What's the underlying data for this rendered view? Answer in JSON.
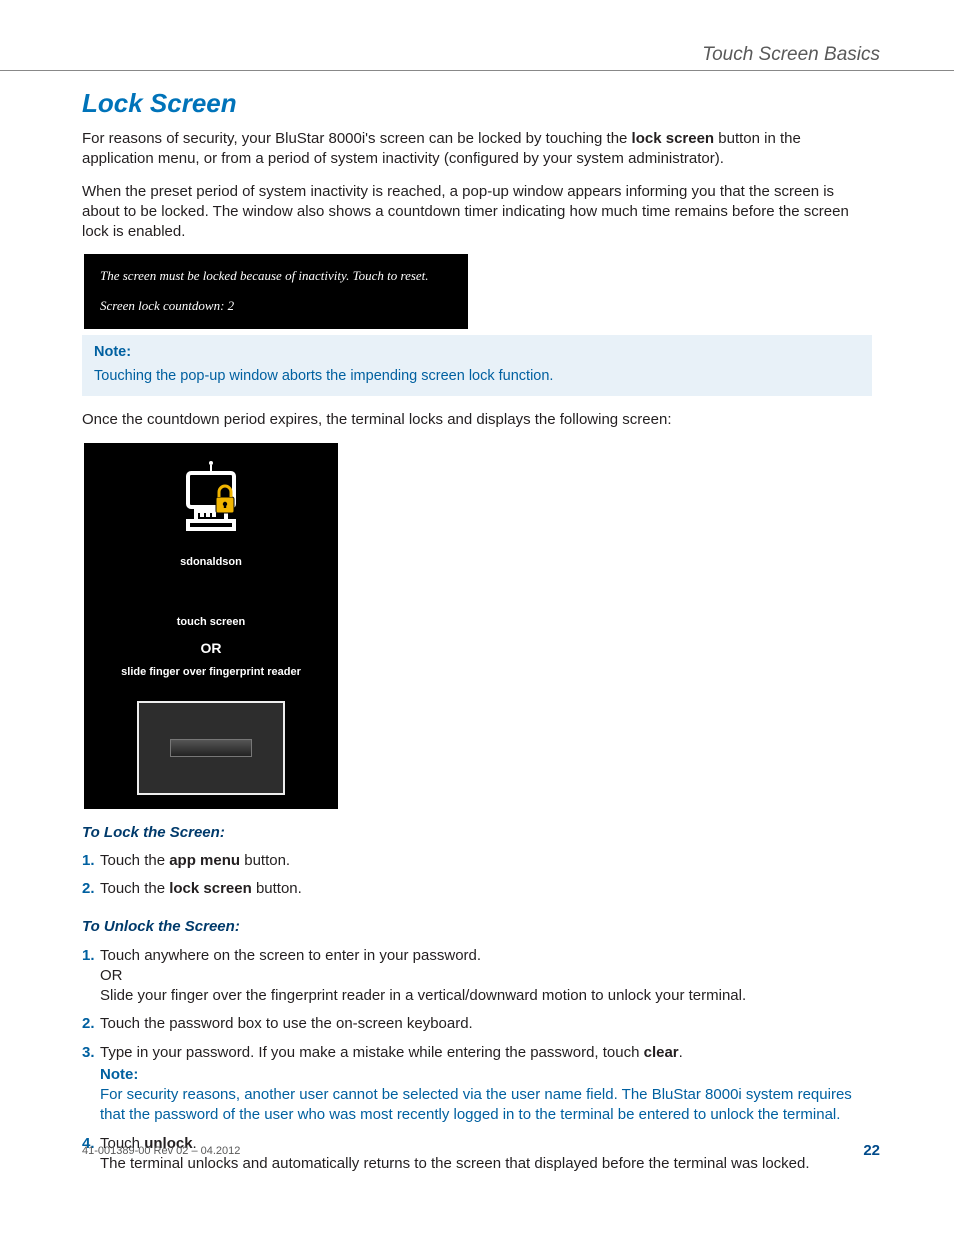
{
  "header": {
    "section": "Touch Screen Basics"
  },
  "title": "Lock Screen",
  "intro": {
    "p1_a": "For reasons of security, your BluStar 8000i's screen can be locked by touching the ",
    "p1_bold": "lock screen",
    "p1_b": " button in the application menu, or from a period of system inactivity (configured by your system administrator).",
    "p2": "When the preset period of system inactivity is reached, a pop-up window appears informing you that the screen is about to be locked. The window also shows a countdown timer indicating how much time remains before the screen lock is enabled."
  },
  "popup": {
    "line1": "The screen must be locked because of inactivity. Touch to reset.",
    "line2": "Screen lock countdown: 2"
  },
  "note1": {
    "label": "Note:",
    "body": "Touching the pop-up window aborts the impending screen lock function."
  },
  "post_note": "Once the countdown period expires, the terminal locks and displays the following screen:",
  "lock": {
    "username": "sdonaldson",
    "touch": "touch screen",
    "or": "OR",
    "slide": "slide finger over fingerprint reader"
  },
  "sec_lock": {
    "heading": "To Lock the Screen:",
    "step1_a": "Touch the ",
    "step1_bold": "app menu",
    "step1_b": " button.",
    "step2_a": "Touch the ",
    "step2_bold": "lock screen",
    "step2_b": " button."
  },
  "sec_unlock": {
    "heading": "To Unlock the Screen:",
    "s1_a": "Touch anywhere on the screen to enter in your password.",
    "s1_or": "OR",
    "s1_b": "Slide your finger over the fingerprint reader in a vertical/downward motion to unlock your terminal.",
    "s2": "Touch the password box to use the on-screen keyboard.",
    "s3_a": "Type in your password. If you make a mistake while entering the password, touch ",
    "s3_bold": "clear",
    "s3_b": ".",
    "s3_note_label": "Note:",
    "s3_note_body": "For security reasons, another user cannot be selected via the user name field. The BluStar 8000i system requires that the password of the user who was most recently logged in to the terminal be entered to unlock the terminal.",
    "s4_a": "Touch ",
    "s4_bold": "unlock",
    "s4_b": ".",
    "s4_extra": "The terminal unlocks and automatically returns to the screen that displayed before the terminal was locked."
  },
  "nums": {
    "n1": "1.",
    "n2": "2.",
    "n3": "3.",
    "n4": "4."
  },
  "footer": {
    "left": "41-001389-00 Rev 02 – 04.2012",
    "page": "22"
  }
}
